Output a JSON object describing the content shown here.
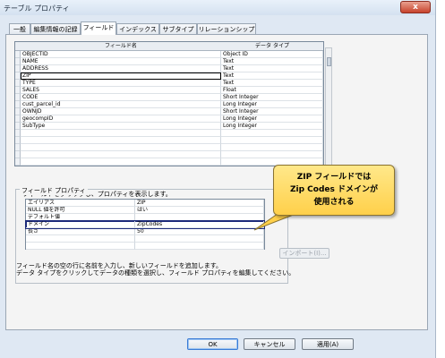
{
  "window": {
    "title": "テーブル プロパティ",
    "close_symbol": "x"
  },
  "tabs": [
    {
      "label": "一般"
    },
    {
      "label": "編集情報の記録"
    },
    {
      "label": "フィールド"
    },
    {
      "label": "インデックス"
    },
    {
      "label": "サブタイプ"
    },
    {
      "label": "リレーションシップ"
    }
  ],
  "fields_grid": {
    "headers": [
      "フィールド名",
      "データ タイプ"
    ],
    "rows": [
      [
        "OBJECTID",
        "Object ID"
      ],
      [
        "NAME",
        "Text"
      ],
      [
        "ADDRESS",
        "Text"
      ],
      [
        "ZIP",
        "Text"
      ],
      [
        "TYPE",
        "Text"
      ],
      [
        "SALES",
        "Float"
      ],
      [
        "CODE",
        "Short Integer"
      ],
      [
        "cust_parcel_id",
        "Long Integer"
      ],
      [
        "OWNJD",
        "Short Integer"
      ],
      [
        "geocompID",
        "Long Integer"
      ],
      [
        "SubType",
        "Long Integer"
      ]
    ],
    "selected_index": 3
  },
  "hint_text": "フィールドをクリックし、プロパティを表示します。",
  "field_properties": {
    "group_label": "フィールド プロパティ",
    "rows": [
      [
        "エイリアス",
        "ZIP"
      ],
      [
        "NULL 値を許可",
        "はい"
      ],
      [
        "デフォルト値",
        ""
      ],
      [
        "ドメイン",
        "ZipCodes"
      ],
      [
        "長さ",
        "50"
      ]
    ]
  },
  "import_button": "インポート(I)...",
  "note_lines": [
    "フィールド名の空の行に名前を入力し、新しいフィールドを追加します。",
    "データ タイプをクリックしてデータの種類を選択し、フィールド プロパティを編集してください。"
  ],
  "callout": {
    "line1": "ZIP フィールドでは",
    "line2": "Zip Codes ドメインが",
    "line3": "使用される"
  },
  "buttons": {
    "ok": "OK",
    "cancel": "キャンセル",
    "apply": "適用(A)"
  },
  "colors": {
    "callout_fill": "#ffd04a",
    "domain_outline": "#1c2a7a"
  }
}
